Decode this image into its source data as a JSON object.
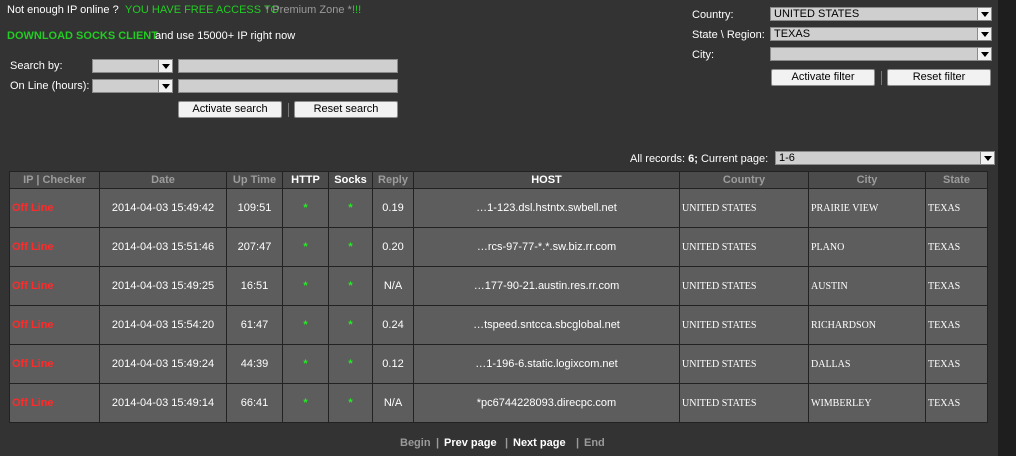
{
  "banner": {
    "not_enough": "Not enough IP online ?",
    "free_access": "YOU HAVE FREE ACCESS TO",
    "premium": "* Premium Zone *",
    "excl": "!!!",
    "download_link": "DOWNLOAD SOCKS CLIENT",
    "download_rest": "and use 15000+ IP right now"
  },
  "search": {
    "search_by_label": "Search by:",
    "online_label": "On Line (hours):",
    "search_by_value": "",
    "online_value": "",
    "search_text": "",
    "online_text": "",
    "activate_label": "Activate search",
    "reset_label": "Reset search"
  },
  "filter": {
    "country_label": "Country:",
    "country_value": "UNITED STATES",
    "region_label": "State \\ Region:",
    "region_value": "TEXAS",
    "city_label": "City:",
    "city_value": "",
    "activate_label": "Activate filter",
    "reset_label": "Reset filter"
  },
  "records": {
    "prefix": "All records:",
    "count": "6;",
    "page_label": "Current page:",
    "page_value": "1-6"
  },
  "table": {
    "headers": [
      "IP | Checker",
      "Date",
      "Up Time",
      "HTTP",
      "Socks",
      "Reply",
      "HOST",
      "Country",
      "City",
      "State"
    ],
    "rows": [
      {
        "status": "Off Line",
        "date": "2014-04-03 15:49:42",
        "uptime": "109:51",
        "http": "*",
        "socks": "*",
        "reply": "0.19",
        "host": "…1-123.dsl.hstntx.swbell.net",
        "country": "UNITED STATES",
        "city": "PRAIRIE VIEW",
        "state": "TEXAS"
      },
      {
        "status": "Off Line",
        "date": "2014-04-03 15:51:46",
        "uptime": "207:47",
        "http": "*",
        "socks": "*",
        "reply": "0.20",
        "host": "…rcs-97-77-*.*.sw.biz.rr.com",
        "country": "UNITED STATES",
        "city": "PLANO",
        "state": "TEXAS"
      },
      {
        "status": "Off Line",
        "date": "2014-04-03 15:49:25",
        "uptime": "16:51",
        "http": "*",
        "socks": "*",
        "reply": "N/A",
        "host": "…177-90-21.austin.res.rr.com",
        "country": "UNITED STATES",
        "city": "AUSTIN",
        "state": "TEXAS"
      },
      {
        "status": "Off Line",
        "date": "2014-04-03 15:54:20",
        "uptime": "61:47",
        "http": "*",
        "socks": "*",
        "reply": "0.24",
        "host": "…tspeed.sntcca.sbcglobal.net",
        "country": "UNITED STATES",
        "city": "RICHARDSON",
        "state": "TEXAS"
      },
      {
        "status": "Off Line",
        "date": "2014-04-03 15:49:24",
        "uptime": "44:39",
        "http": "*",
        "socks": "*",
        "reply": "0.12",
        "host": "…1-196-6.static.logixcom.net",
        "country": "UNITED STATES",
        "city": "DALLAS",
        "state": "TEXAS"
      },
      {
        "status": "Off Line",
        "date": "2014-04-03 15:49:14",
        "uptime": "66:41",
        "http": "*",
        "socks": "*",
        "reply": "N/A",
        "host": "*pc6744228093.direcpc.com",
        "country": "UNITED STATES",
        "city": "WIMBERLEY",
        "state": "TEXAS"
      }
    ]
  },
  "pager": {
    "begin": "Begin",
    "sep": "|",
    "prev": "Prev page",
    "next": "Next page",
    "end": "End"
  },
  "colors": {
    "background": "#333333",
    "accent_green": "#22cc22",
    "offline_red": "#ff2a2a"
  }
}
